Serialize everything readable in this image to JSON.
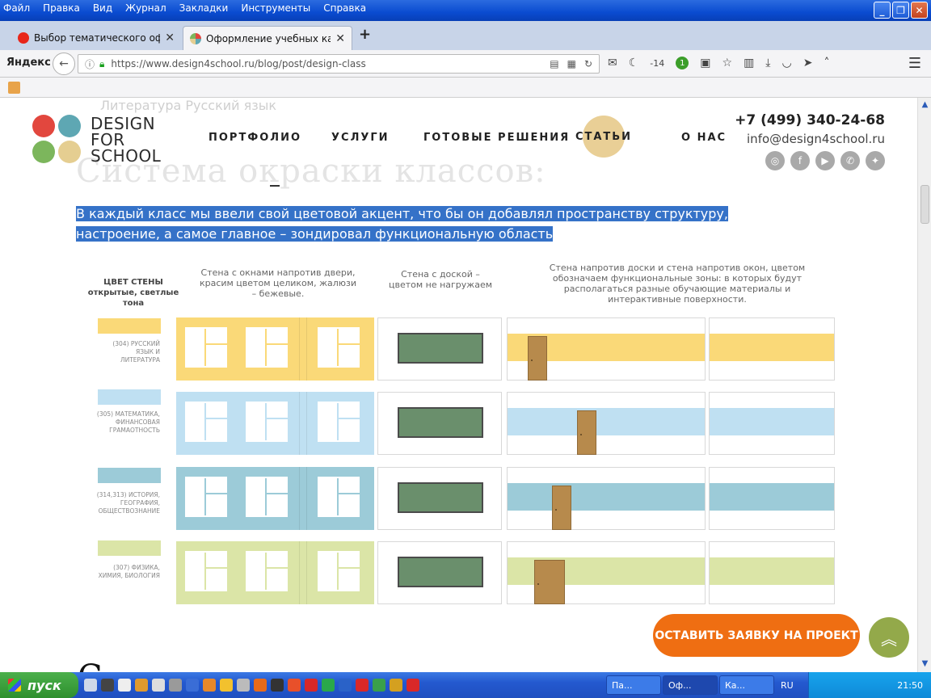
{
  "window": {
    "menus": [
      "Файл",
      "Правка",
      "Вид",
      "Журнал",
      "Закладки",
      "Инструменты",
      "Справка"
    ]
  },
  "tabs": [
    {
      "title": "Выбор тематического офор...",
      "favicon_color": "#e8261a"
    },
    {
      "title": "Оформление учебных каби...",
      "favicon_color": "#6aa84f"
    }
  ],
  "navbar": {
    "brand": "Яндекс",
    "url": "https://www.design4school.ru/blog/post/design-class",
    "temperature": "-14",
    "badge": "1"
  },
  "site": {
    "ghost_list_item": "Литература Русский язык",
    "ghost_title": "Система окраски классов:",
    "logo_lines": [
      "DESIGN",
      "FOR",
      "SCHOOL"
    ],
    "logo_colors": [
      "#e2473e",
      "#5ea7b3",
      "#7cb65c",
      "#e5ce91"
    ],
    "nav": [
      "ПОРТФОЛИО",
      "УСЛУГИ",
      "ГОТОВЫЕ РЕШЕНИЯ",
      "СТАТЬИ",
      "О НАС"
    ],
    "phone": "+7 (499) 340-24-68",
    "email": "info@design4school.ru",
    "highlight_text": "В каждый класс мы ввели свой цветовой акцент, что бы он добавлял пространству структуру, настроение, а самое главное – зондировал функциональную область",
    "cta": "ОСТАВИТЬ ЗАЯВКУ НА ПРОЕКТ",
    "bottom_text": "С"
  },
  "diagram": {
    "col_headers": {
      "wall_color": "ЦВЕТ СТЕНЫ",
      "wall_color_sub": "открытые, светлые тона",
      "windows": "Стена с окнами напротив двери, красим цветом целиком, жалюзи – бежевые.",
      "board": "Стена с доской – цветом не нагружаем",
      "opposite": "Стена напротив доски и стена напротив окон, цветом обозначаем функциональные зоны: в которых будут располагаться разные обучающие материалы и интерактивные поверхности."
    },
    "rows": [
      {
        "label": "(304) РУССКИЙ ЯЗЫК И ЛИТЕРАТУРА",
        "color": "#fad978"
      },
      {
        "label": "(305) МАТЕМАТИКА, ФИНАНСОВАЯ ГРАМАОТНОСТЬ",
        "color": "#bfe0f2"
      },
      {
        "label": "(314,313) ИСТОРИЯ, ГЕОГРАФИЯ, ОБЩЕСТВОЗНАНИЕ",
        "color": "#9ccbd8"
      },
      {
        "label": "(307) ФИЗИКА, ХИМИЯ, БИОЛОГИЯ",
        "color": "#dbe5a7"
      }
    ]
  },
  "taskbar": {
    "start": "пуск",
    "tasks": [
      "Па...",
      "Оф...",
      "Ка..."
    ],
    "lang": "RU",
    "clock": "21:50"
  }
}
